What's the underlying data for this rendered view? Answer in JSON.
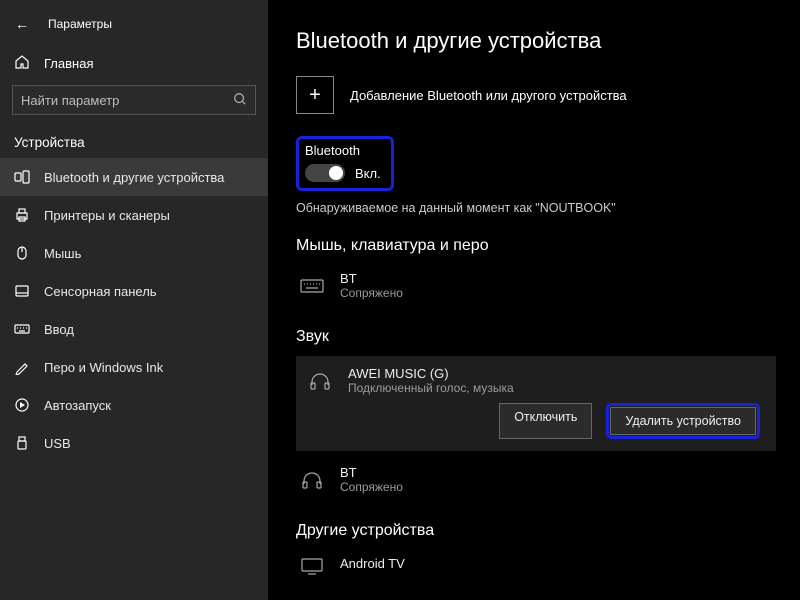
{
  "header": {
    "title": "Параметры"
  },
  "sidebar": {
    "home": "Главная",
    "search_placeholder": "Найти параметр",
    "group": "Устройства",
    "items": [
      {
        "label": "Bluetooth и другие устройства"
      },
      {
        "label": "Принтеры и сканеры"
      },
      {
        "label": "Мышь"
      },
      {
        "label": "Сенсорная панель"
      },
      {
        "label": "Ввод"
      },
      {
        "label": "Перо и Windows Ink"
      },
      {
        "label": "Автозапуск"
      },
      {
        "label": "USB"
      }
    ]
  },
  "main": {
    "title": "Bluetooth и другие устройства",
    "add_label": "Добавление Bluetooth или другого устройства",
    "bt_label": "Bluetooth",
    "bt_state": "Вкл.",
    "discover": "Обнаруживаемое на данный момент как \"NOUTBOOK\"",
    "sec_mouse": "Мышь, клавиатура и перо",
    "kb_bt": {
      "name": "BT",
      "status": "Сопряжено"
    },
    "sec_sound": "Звук",
    "awei": {
      "name": "AWEI MUSIC (G)",
      "status": "Подключенный голос, музыка"
    },
    "btn_disconnect": "Отключить",
    "btn_remove": "Удалить устройство",
    "bt2": {
      "name": "BT",
      "status": "Сопряжено"
    },
    "sec_other": "Другие устройства",
    "tv": {
      "name": "Android TV"
    }
  }
}
